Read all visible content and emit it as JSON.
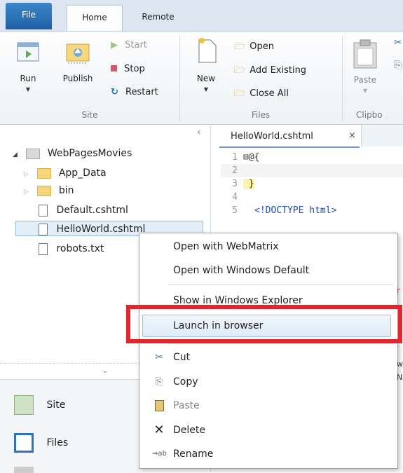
{
  "ribbon": {
    "tabs": {
      "file": "File",
      "home": "Home",
      "remote": "Remote"
    },
    "site_group": {
      "run": "Run",
      "publish": "Publish",
      "start": "Start",
      "stop": "Stop",
      "restart": "Restart",
      "label": "Site"
    },
    "files_group": {
      "new": "New",
      "open": "Open",
      "add_existing": "Add Existing",
      "close_all": "Close All",
      "label": "Files"
    },
    "clipboard_group": {
      "paste": "Paste",
      "label": "Clipbo"
    }
  },
  "explorer": {
    "root": "WebPagesMovies",
    "items": [
      {
        "name": "App_Data"
      },
      {
        "name": "bin"
      },
      {
        "name": "Default.cshtml"
      },
      {
        "name": "HelloWorld.cshtml"
      },
      {
        "name": "robots.txt"
      }
    ],
    "nav": {
      "site": "Site",
      "files": "Files"
    }
  },
  "editor": {
    "tab_title": "HelloWorld.cshtml",
    "tab_close": "×",
    "lines": [
      {
        "num": "1",
        "code": "⊟@{"
      },
      {
        "num": "2",
        "code": ""
      },
      {
        "num": "3",
        "code": " }"
      },
      {
        "num": "4",
        "code": ""
      },
      {
        "num": "5",
        "code": "<!DOCTYPE html>"
      }
    ]
  },
  "context_menu": {
    "open_webmatrix": "Open with WebMatrix",
    "open_windows_default": "Open with Windows Default",
    "show_explorer": "Show in Windows Explorer",
    "launch_browser": "Launch in browser",
    "cut": "Cut",
    "copy": "Copy",
    "paste": "Paste",
    "delete": "Delete",
    "rename": "Rename",
    "rename_icon_text": "ab"
  },
  "colors": {
    "highlight_box": "#e3262d",
    "file_tab": "#1f5fa6"
  }
}
